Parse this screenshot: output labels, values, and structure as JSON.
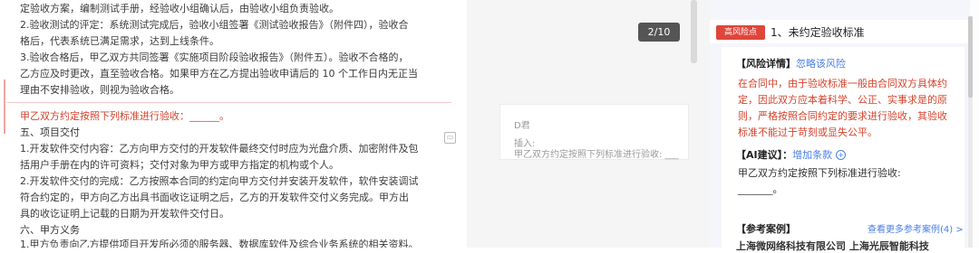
{
  "doc": {
    "lines": [
      "定验收方案，编制测试手册，经验收小组确认后，由验收小组负责验收。",
      "2.验收测试的评定：系统测试完成后，验收小组签署《测试验收报告》（附件四），验收合",
      "格后，代表系统已满足需求，达到上线条件。",
      "3.验收合格后，甲乙双方共同签署《实施项目阶段验收报告》（附件五）。验收不合格的，",
      "乙方应及时更改，直至验收合格。如果甲方在乙方提出验收申请后的 10 个工作日内无正当",
      "理由不安排验收，则视为验收合格。",
      "甲乙双方约定按照下列标准进行验收：______。",
      "五、项目交付",
      "1.开发软件交付内容：乙方向甲方交付的开发软件最终交付时应为光盘介质、加密附件及包",
      "括用户手册在内的许可资料；交付对象为甲方或甲方指定的机构或个人。",
      "2.开发软件交付的完成：乙方按照本合同的约定向甲方交付并安装开发软件，软件安装调试",
      "符合约定的，甲方向乙方出具书面收讫证明之后，乙方的开发软件交付义务完成。甲方出",
      "具的收讫证明上记载的日期为开发软件交付日。",
      "六、甲方义务",
      "1.甲方负责向乙方提供项目开发所必须的服务器、数据库软件及综合业务系统的相关资料。"
    ]
  },
  "comment_icon": "comment-icon",
  "page_indicator": "2/10",
  "mid_card": {
    "author": "D君",
    "action": "插入:",
    "content": "甲乙双方约定按照下列标准进行验收: ___"
  },
  "risk": {
    "badge": "高风险点",
    "title": "1、未约定验收标准",
    "detail_label": "【风险详情】",
    "ignore_link": "忽略该风险",
    "detail_lines": [
      "在合同中，由于验收标准一般由合同双方具体约",
      "定，因此双方应本着科学、公正、实事求是的原",
      "则，严格按照合同约定的要求进行验收，其验收",
      "标准不能过于苛刻或显失公平。"
    ],
    "ai_label": "【AI建议】：",
    "ai_link": "增加条款",
    "ai_lines": [
      "甲乙双方约定按照下列标准进行验收:",
      "_______。"
    ],
    "ref_label": "【参考案例】",
    "ref_link": "查看更多参考案例(4) >",
    "ref_partial": "上海微网络科技有限公司   上海光辰智能科技"
  },
  "colors": {
    "accent_red": "#e0453a",
    "risk_text": "#d6432d",
    "link_blue": "#4a7ee8"
  }
}
